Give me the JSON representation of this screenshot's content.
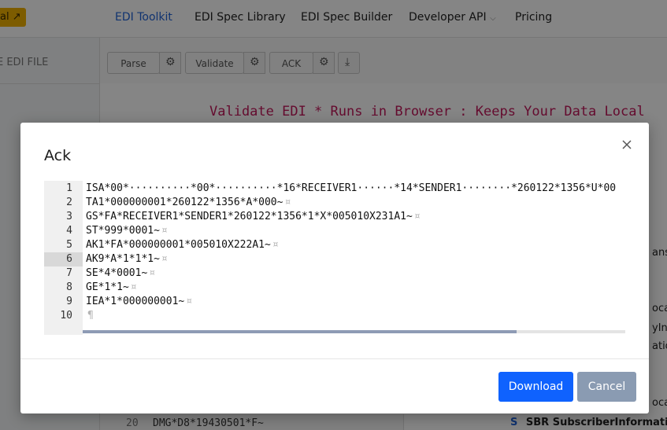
{
  "nav": {
    "badge": "al",
    "links": [
      "EDI Toolkit",
      "EDI Spec Library",
      "EDI Spec Builder",
      "Developer API",
      "Pricing"
    ]
  },
  "left_panel": {
    "header": "E EDI FILE"
  },
  "toolbar": {
    "parse_label": "Parse",
    "validate_label": "Validate",
    "ack_label": "ACK"
  },
  "banner": "Validate EDI * Runs in Browser : Keeps Your Data Local",
  "background_editor": {
    "line_number": "20",
    "line_text": "DMG*D8*19430501*F~"
  },
  "side_fragments": [
    "ans",
    "ocalL",
    "yInf",
    "ation",
    "ocalL"
  ],
  "tree_item": {
    "icon": "S",
    "label": "SBR SubscriberInformation"
  },
  "modal": {
    "title": "Ack",
    "active_line": 6,
    "lines": [
      {
        "num": "1",
        "text": "ISA*00*··········*00*··········*16*RECEIVER1······*14*SENDER1········*260122*1356*U*00",
        "eol": ""
      },
      {
        "num": "2",
        "text": "TA1*000000001*260122*1356*A*000~",
        "eol": "¤"
      },
      {
        "num": "3",
        "text": "GS*FA*RECEIVER1*SENDER1*260122*1356*1*X*005010X231A1~",
        "eol": "¤"
      },
      {
        "num": "4",
        "text": "ST*999*0001~",
        "eol": "¤"
      },
      {
        "num": "5",
        "text": "AK1*FA*000000001*005010X222A1~",
        "eol": "¤"
      },
      {
        "num": "6",
        "text": "AK9*A*1*1*1~",
        "eol": "¤"
      },
      {
        "num": "7",
        "text": "SE*4*0001~",
        "eol": "¤"
      },
      {
        "num": "8",
        "text": "GE*1*1~",
        "eol": "¤"
      },
      {
        "num": "9",
        "text": "IEA*1*000000001~",
        "eol": "¤"
      },
      {
        "num": "10",
        "text": "",
        "eol": "¶"
      }
    ],
    "scroll_fraction": 0.8,
    "download_label": "Download",
    "cancel_label": "Cancel"
  },
  "colors": {
    "accent": "#0f62fe",
    "banner": "#c2185b",
    "secondary": "#8a9bb2"
  }
}
